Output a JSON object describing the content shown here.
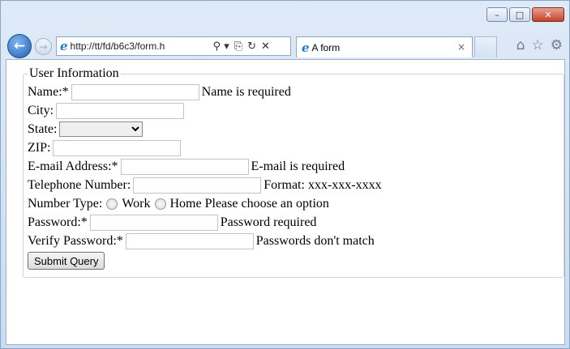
{
  "browser": {
    "url": "http://tt/fd/b6c3/form.h",
    "tab_title": "A form",
    "tab_close": "×",
    "back": "←",
    "forward": "→",
    "search_glyph": "⚲ ▾",
    "compat_glyph": "⎘",
    "refresh_glyph": "↻",
    "stop_glyph": "✕",
    "home_glyph": "⌂",
    "favorites_glyph": "☆",
    "tools_glyph": "⚙",
    "minimize": "–",
    "maximize": "□",
    "close": "✕"
  },
  "form": {
    "legend": "User Information",
    "name_label": "Name:*",
    "name_error": "Name is required",
    "city_label": "City:",
    "state_label": "State:",
    "state_value": "",
    "zip_label": "ZIP:",
    "email_label": "E-mail Address:*",
    "email_error": "E-mail is required",
    "phone_label": "Telephone Number:",
    "phone_hint": "Format: xxx-xxx-xxxx",
    "number_type_label": "Number Type:",
    "radio_work": "Work",
    "radio_home": "Home",
    "number_type_error": "Please choose an option",
    "password_label": "Password:*",
    "password_error": "Password required",
    "verify_label": "Verify Password:*",
    "verify_error": "Passwords don't match",
    "submit_label": "Submit Query"
  }
}
